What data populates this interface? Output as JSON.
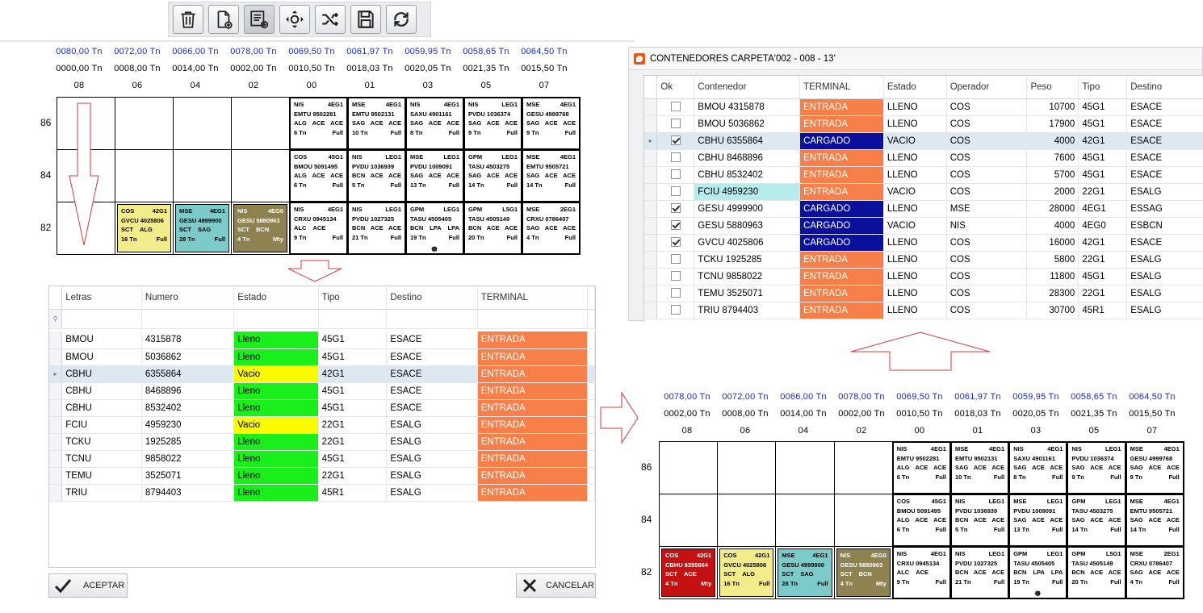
{
  "toolbar": {
    "buttons": [
      {
        "name": "delete",
        "icon": "trash-icon"
      },
      {
        "name": "new-document",
        "icon": "document-add-icon"
      },
      {
        "name": "list-add",
        "icon": "list-add-icon",
        "active": true
      },
      {
        "name": "move",
        "icon": "move-arrows-icon"
      },
      {
        "name": "shuffle",
        "icon": "shuffle-icon"
      },
      {
        "name": "save",
        "icon": "save-icon"
      },
      {
        "name": "refresh",
        "icon": "refresh-icon"
      }
    ]
  },
  "bay_top": {
    "weights_max": [
      "0080,00 Tn",
      "0072,00 Tn",
      "0066,00 Tn",
      "0078,00 Tn",
      "0069,50 Tn",
      "0061,97 Tn",
      "0059,95 Tn",
      "0058,65 Tn",
      "0064,50 Tn"
    ],
    "weights_cur": [
      "0000,00 Tn",
      "0008,00 Tn",
      "0014,00 Tn",
      "0002,00 Tn",
      "0010,50 Tn",
      "0018,03 Tn",
      "0020,05 Tn",
      "0021,35 Tn",
      "0015,50 Tn"
    ],
    "columns": [
      "08",
      "06",
      "04",
      "02",
      "00",
      "01",
      "03",
      "05",
      "07"
    ],
    "rows": [
      "86",
      "84",
      "82"
    ]
  },
  "bay_bottom": {
    "weights_max": [
      "0078,00 Tn",
      "0072,00 Tn",
      "0066,00 Tn",
      "0078,00 Tn",
      "0069,50 Tn",
      "0061,97 Tn",
      "0059,95 Tn",
      "0058,65 Tn",
      "0064,50 Tn"
    ],
    "weights_cur": [
      "0002,00 Tn",
      "0008,00 Tn",
      "0014,00 Tn",
      "0002,00 Tn",
      "0010,50 Tn",
      "0018,03 Tn",
      "0020,05 Tn",
      "0021,35 Tn",
      "0015,50 Tn"
    ],
    "columns": [
      "08",
      "06",
      "04",
      "02",
      "00",
      "01",
      "03",
      "05",
      "07"
    ],
    "rows": [
      "86",
      "84",
      "82"
    ]
  },
  "containers_top": [
    {
      "col": 4,
      "row": 0,
      "l1": [
        "NIS",
        "4EG1"
      ],
      "l2": "EMTU 9502281",
      "l3": [
        "ALG",
        "ACE",
        "ACE"
      ],
      "l4": [
        "6 Tn",
        "Full"
      ]
    },
    {
      "col": 5,
      "row": 0,
      "l1": [
        "MSE",
        "4EG1"
      ],
      "l2": "EMTU 9502131",
      "l3": [
        "SAG",
        "ACE",
        "ACE"
      ],
      "l4": [
        "10 Tn",
        "Full"
      ]
    },
    {
      "col": 6,
      "row": 0,
      "l1": [
        "NIS",
        "4EG1"
      ],
      "l2": "SAXU 4901161",
      "l3": [
        "SAG",
        "ACE",
        "ACE"
      ],
      "l4": [
        "8 Tn",
        "Full"
      ]
    },
    {
      "col": 7,
      "row": 0,
      "l1": [
        "NIS",
        "LEG1"
      ],
      "l2": "PVDU 1036374",
      "l3": [
        "SAG",
        "ACE",
        "ACE"
      ],
      "l4": [
        "9 Tn",
        "Full"
      ]
    },
    {
      "col": 8,
      "row": 0,
      "l1": [
        "MSE",
        "4EG1"
      ],
      "l2": "GESU 4999768",
      "l3": [
        "SAG",
        "ACE",
        "ACE"
      ],
      "l4": [
        "9 Tn",
        "Full"
      ]
    },
    {
      "col": 4,
      "row": 1,
      "l1": [
        "COS",
        "45G1"
      ],
      "l2": "BMOU 5091495",
      "l3": [
        "ALG",
        "ACE",
        "ACE"
      ],
      "l4": [
        "6 Tn",
        "Full"
      ]
    },
    {
      "col": 5,
      "row": 1,
      "l1": [
        "NIS",
        "LEG1"
      ],
      "l2": "PVDU 1036939",
      "l3": [
        "BCN",
        "ACE",
        "ACE"
      ],
      "l4": [
        "5 Tn",
        "Full"
      ]
    },
    {
      "col": 6,
      "row": 1,
      "l1": [
        "MSE",
        "LEG1"
      ],
      "l2": "PVDU 1009091",
      "l3": [
        "SAG",
        "ACE",
        "ACE"
      ],
      "l4": [
        "13 Tn",
        "Full"
      ]
    },
    {
      "col": 7,
      "row": 1,
      "l1": [
        "GPM",
        "LEG1"
      ],
      "l2": "TASU 4503275",
      "l3": [
        "SAG",
        "ACE",
        "ACE"
      ],
      "l4": [
        "14 Tn",
        "Full"
      ]
    },
    {
      "col": 8,
      "row": 1,
      "l1": [
        "MSE",
        "4EG1"
      ],
      "l2": "EMTU 9505721",
      "l3": [
        "SAG",
        "ACE",
        "ACE"
      ],
      "l4": [
        "14 Tn",
        "Full"
      ]
    },
    {
      "col": 1,
      "row": 2,
      "cls": "yel",
      "l1": [
        "COS",
        "42G1"
      ],
      "l2": "GVCU 4025806",
      "l3": [
        "SCT",
        "ALG"
      ],
      "l4": [
        "16 Tn",
        "Full"
      ]
    },
    {
      "col": 2,
      "row": 2,
      "cls": "cyan",
      "l1": [
        "MSE",
        "4EG1"
      ],
      "l2": "GESU 4999900",
      "l3": [
        "SCT",
        "SAG"
      ],
      "l4": [
        "28 Tn",
        "Full"
      ]
    },
    {
      "col": 3,
      "row": 2,
      "cls": "olive",
      "l1": [
        "NIS",
        "4EG0"
      ],
      "l2": "GESU 5880963",
      "l3": [
        "SCT",
        "BCN"
      ],
      "l4": [
        "4 Tn",
        "Mty"
      ]
    },
    {
      "col": 4,
      "row": 2,
      "l1": [
        "NIS",
        "4EG1"
      ],
      "l2": "CRXU 0945134",
      "l3": [
        "ALC",
        "ACE"
      ],
      "l4": [
        "9 Tn",
        "Full"
      ]
    },
    {
      "col": 5,
      "row": 2,
      "l1": [
        "NIS",
        "LEG1"
      ],
      "l2": "PVDU 1027325",
      "l3": [
        "BCN",
        "ACE",
        "ACE"
      ],
      "l4": [
        "21 Tn",
        "Full"
      ]
    },
    {
      "col": 6,
      "row": 2,
      "l1": [
        "GPM",
        "LEG1"
      ],
      "l2": "TASU 4505405",
      "l3": [
        "BCN",
        "LPA",
        "LPA"
      ],
      "l4": [
        "19 Tn",
        "Full"
      ],
      "flag": true
    },
    {
      "col": 7,
      "row": 2,
      "l1": [
        "GPM",
        "L5G1"
      ],
      "l2": "TASU 4505149",
      "l3": [
        "BCN",
        "ACE",
        "ACE"
      ],
      "l4": [
        "20 Tn",
        "Full"
      ]
    },
    {
      "col": 8,
      "row": 2,
      "l1": [
        "MSE",
        "2EG1"
      ],
      "l2": "CRXU 0786407",
      "l3": [
        "SAG",
        "ACE",
        "ACE"
      ],
      "l4": [
        "4 Tn",
        "Full"
      ]
    }
  ],
  "containers_bottom": [
    {
      "col": 4,
      "row": 0,
      "l1": [
        "NIS",
        "4EG1"
      ],
      "l2": "EMTU 9502281",
      "l3": [
        "ALG",
        "ACE",
        "ACE"
      ],
      "l4": [
        "6 Tn",
        "Full"
      ]
    },
    {
      "col": 5,
      "row": 0,
      "l1": [
        "MSE",
        "4EG1"
      ],
      "l2": "EMTU 9502131",
      "l3": [
        "SAG",
        "ACE",
        "ACE"
      ],
      "l4": [
        "10 Tn",
        "Full"
      ]
    },
    {
      "col": 6,
      "row": 0,
      "l1": [
        "NIS",
        "4EG1"
      ],
      "l2": "SAXU 4901161",
      "l3": [
        "SAG",
        "ACE",
        "ACE"
      ],
      "l4": [
        "8 Tn",
        "Full"
      ]
    },
    {
      "col": 7,
      "row": 0,
      "l1": [
        "NIS",
        "LEG1"
      ],
      "l2": "PVDU 1036374",
      "l3": [
        "SAG",
        "ACE",
        "ACE"
      ],
      "l4": [
        "9 Tn",
        "Full"
      ]
    },
    {
      "col": 8,
      "row": 0,
      "l1": [
        "MSE",
        "4EG1"
      ],
      "l2": "GESU 4999768",
      "l3": [
        "SAG",
        "ACE",
        "ACE"
      ],
      "l4": [
        "9 Tn",
        "Full"
      ]
    },
    {
      "col": 4,
      "row": 1,
      "l1": [
        "COS",
        "45G1"
      ],
      "l2": "BMOU 5091495",
      "l3": [
        "ALG",
        "ACE",
        "ACE"
      ],
      "l4": [
        "6 Tn",
        "Full"
      ]
    },
    {
      "col": 5,
      "row": 1,
      "l1": [
        "NIS",
        "LEG1"
      ],
      "l2": "PVDU 1036939",
      "l3": [
        "BCN",
        "ACE",
        "ACE"
      ],
      "l4": [
        "5 Tn",
        "Full"
      ]
    },
    {
      "col": 6,
      "row": 1,
      "l1": [
        "MSE",
        "LEG1"
      ],
      "l2": "PVDU 1009091",
      "l3": [
        "SAG",
        "ACE",
        "ACE"
      ],
      "l4": [
        "13 Tn",
        "Full"
      ]
    },
    {
      "col": 7,
      "row": 1,
      "l1": [
        "GPM",
        "LEG1"
      ],
      "l2": "TASU 4503275",
      "l3": [
        "SAG",
        "ACE",
        "ACE"
      ],
      "l4": [
        "14 Tn",
        "Full"
      ]
    },
    {
      "col": 8,
      "row": 1,
      "l1": [
        "MSE",
        "4EG1"
      ],
      "l2": "EMTU 9505721",
      "l3": [
        "SAG",
        "ACE",
        "ACE"
      ],
      "l4": [
        "14 Tn",
        "Full"
      ]
    },
    {
      "col": 0,
      "row": 2,
      "cls": "red",
      "l1": [
        "COS",
        "42G1"
      ],
      "l2": "CBHU 6355864",
      "l3": [
        "SCT",
        "ACE"
      ],
      "l4": [
        "4 Tn",
        "Mty"
      ]
    },
    {
      "col": 1,
      "row": 2,
      "cls": "yel",
      "l1": [
        "COS",
        "42G1"
      ],
      "l2": "GVCU 4025806",
      "l3": [
        "SCT",
        "ALG"
      ],
      "l4": [
        "16 Tn",
        "Full"
      ]
    },
    {
      "col": 2,
      "row": 2,
      "cls": "cyan",
      "l1": [
        "MSE",
        "4EG1"
      ],
      "l2": "GESU 4999900",
      "l3": [
        "SCT",
        "SAG"
      ],
      "l4": [
        "28 Tn",
        "Full"
      ]
    },
    {
      "col": 3,
      "row": 2,
      "cls": "olive",
      "l1": [
        "NIS",
        "4EG0"
      ],
      "l2": "GESU 5880963",
      "l3": [
        "SCT",
        "BCN"
      ],
      "l4": [
        "4 Tn",
        "Mty"
      ]
    },
    {
      "col": 4,
      "row": 2,
      "l1": [
        "NIS",
        "4EG1"
      ],
      "l2": "CRXU 0945134",
      "l3": [
        "ALC",
        "ACE"
      ],
      "l4": [
        "9 Tn",
        "Full"
      ]
    },
    {
      "col": 5,
      "row": 2,
      "l1": [
        "NIS",
        "LEG1"
      ],
      "l2": "PVDU 1027325",
      "l3": [
        "BCN",
        "ACE",
        "ACE"
      ],
      "l4": [
        "21 Tn",
        "Full"
      ]
    },
    {
      "col": 6,
      "row": 2,
      "l1": [
        "GPM",
        "LEG1"
      ],
      "l2": "TASU 4505405",
      "l3": [
        "BCN",
        "LPA",
        "LPA"
      ],
      "l4": [
        "19 Tn",
        "Full"
      ],
      "flag": true
    },
    {
      "col": 7,
      "row": 2,
      "l1": [
        "GPM",
        "L5G1"
      ],
      "l2": "TASU 4505149",
      "l3": [
        "BCN",
        "ACE",
        "ACE"
      ],
      "l4": [
        "20 Tn",
        "Full"
      ]
    },
    {
      "col": 8,
      "row": 2,
      "l1": [
        "MSE",
        "2EG1"
      ],
      "l2": "CRXU 0786407",
      "l3": [
        "SAG",
        "ACE",
        "ACE"
      ],
      "l4": [
        "4 Tn",
        "Full"
      ]
    }
  ],
  "dialog": {
    "headers": [
      "Letras",
      "Numero",
      "Estado",
      "Tipo",
      "Destino",
      "TERMINAL"
    ],
    "rows": [
      [
        "BMOU",
        "4315878",
        "Lleno",
        "45G1",
        "ESACE",
        "ENTRADA"
      ],
      [
        "BMOU",
        "5036862",
        "Lleno",
        "45G1",
        "ESACE",
        "ENTRADA"
      ],
      [
        "CBHU",
        "6355864",
        "Vacio",
        "42G1",
        "ESACE",
        "ENTRADA"
      ],
      [
        "CBHU",
        "8468896",
        "Lleno",
        "45G1",
        "ESACE",
        "ENTRADA"
      ],
      [
        "CBHU",
        "8532402",
        "Lleno",
        "45G1",
        "ESACE",
        "ENTRADA"
      ],
      [
        "FCIU",
        "4959230",
        "Vacio",
        "22G1",
        "ESALG",
        "ENTRADA"
      ],
      [
        "TCKU",
        "1925285",
        "Lleno",
        "22G1",
        "ESALG",
        "ENTRADA"
      ],
      [
        "TCNU",
        "9858022",
        "Lleno",
        "45G1",
        "ESALG",
        "ENTRADA"
      ],
      [
        "TEMU",
        "3525071",
        "Lleno",
        "22G1",
        "ESALG",
        "ENTRADA"
      ],
      [
        "TRIU",
        "8794403",
        "Lleno",
        "45R1",
        "ESALG",
        "ENTRADA"
      ]
    ],
    "selected_row": 2,
    "accept_label": "ACEPTAR",
    "cancel_label": "CANCELAR"
  },
  "window": {
    "title": "CONTENEDORES CARPETA'002 - 008 - 13'",
    "headers": [
      "Ok",
      "Contenedor",
      "TERMINAL",
      "Estado",
      "Operador",
      "Peso",
      "Tipo",
      "Destino"
    ],
    "rows": [
      [
        false,
        "BMOU 4315878",
        "ENTRADA",
        "LLENO",
        "COS",
        "10700",
        "45G1",
        "ESACE"
      ],
      [
        false,
        "BMOU 5036862",
        "ENTRADA",
        "LLENO",
        "COS",
        "17900",
        "45G1",
        "ESACE"
      ],
      [
        true,
        "CBHU 6355864",
        "CARGADO",
        "VACIO",
        "COS",
        "4000",
        "42G1",
        "ESACE"
      ],
      [
        false,
        "CBHU 8468896",
        "ENTRADA",
        "LLENO",
        "COS",
        "7600",
        "45G1",
        "ESACE"
      ],
      [
        false,
        "CBHU 8532402",
        "ENTRADA",
        "LLENO",
        "COS",
        "5700",
        "45G1",
        "ESACE"
      ],
      [
        false,
        "FCIU 4959230",
        "ENTRADA",
        "VACIO",
        "COS",
        "2000",
        "22G1",
        "ESALG"
      ],
      [
        true,
        "GESU 4999900",
        "CARGADO",
        "LLENO",
        "MSE",
        "28000",
        "4EG1",
        "ESSAG"
      ],
      [
        true,
        "GESU 5880963",
        "CARGADO",
        "VACIO",
        "NIS",
        "4000",
        "4EG0",
        "ESBCN"
      ],
      [
        true,
        "GVCU 4025806",
        "CARGADO",
        "LLENO",
        "COS",
        "16000",
        "42G1",
        "ESACE"
      ],
      [
        false,
        "TCKU 1925285",
        "ENTRADA",
        "LLENO",
        "COS",
        "5800",
        "22G1",
        "ESALG"
      ],
      [
        false,
        "TCNU 9858022",
        "ENTRADA",
        "LLENO",
        "COS",
        "11800",
        "45G1",
        "ESALG"
      ],
      [
        false,
        "TEMU 3525071",
        "ENTRADA",
        "LLENO",
        "COS",
        "28300",
        "22G1",
        "ESALG"
      ],
      [
        false,
        "TRIU 8794403",
        "ENTRADA",
        "LLENO",
        "COS",
        "30700",
        "45R1",
        "ESALG"
      ]
    ],
    "selected_row": 2,
    "highlight_row": 5
  },
  "colors": {
    "entrada": "#f7804a",
    "cargado": "#0b109c",
    "lleno": "#1bef1b",
    "vacio": "#fbfb00"
  }
}
